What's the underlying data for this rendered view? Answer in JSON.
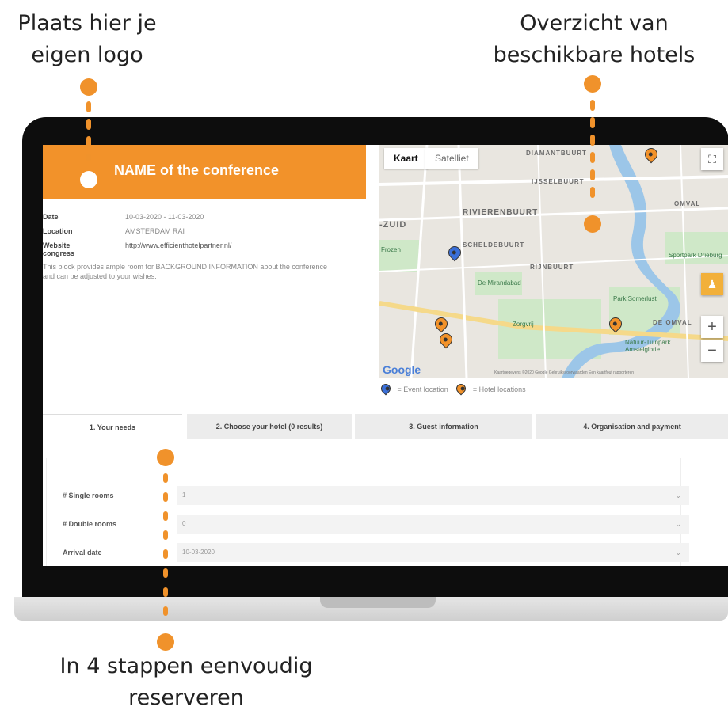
{
  "callouts": {
    "logo": [
      "Plaats hier je",
      "eigen logo"
    ],
    "hotels": [
      "Overzicht van",
      "beschikbare hotels"
    ],
    "steps": [
      "In 4 stappen eenvoudig",
      "reserveren"
    ]
  },
  "conference": {
    "title": "NAME of the conference",
    "info": [
      {
        "label": "Date",
        "value": "10-03-2020 - 11-03-2020"
      },
      {
        "label": "Location",
        "value": "AMSTERDAM RAI"
      },
      {
        "label": "Website congress",
        "value": "http://www.efficienthotelpartner.nl/"
      }
    ],
    "description": "This block provides ample room for BACKGROUND INFORMATION about the conference and can be adjusted to your wishes."
  },
  "map": {
    "tabs": {
      "kaart": "Kaart",
      "satelliet": "Satelliet"
    },
    "labels": [
      "DIAMANTBUURT",
      "IJSSELBUURT",
      "RIVIERENBUURT",
      "-ZUID",
      "SCHELDEBUURT",
      "RIJNBUURT",
      "DE OMVAL",
      "OMVAL"
    ],
    "parks": [
      "De Mirandabad",
      "Zorgvrij",
      "Park Somerlust",
      "Natuur-Tuinpark Amstelglorie",
      "Sportpark Drieburg",
      "Frozen"
    ],
    "google": "Google",
    "attribution": "Kaartgegevens ©2020 Google   Gebruiksvoorwaarden   Een kaartfout rapporteren",
    "zoom_in": "+",
    "zoom_out": "−"
  },
  "legend": {
    "event": "= Event location",
    "hotel": "= Hotel locations"
  },
  "steps": [
    {
      "label": "1. Your needs"
    },
    {
      "label": "2. Choose your hotel (0 results)"
    },
    {
      "label": "3. Guest information"
    },
    {
      "label": "4. Organisation and payment"
    }
  ],
  "form": {
    "fields": [
      {
        "label": "# Single rooms",
        "value": "1"
      },
      {
        "label": "# Double rooms",
        "value": "0"
      },
      {
        "label": "Arrival date",
        "value": "10-03-2020"
      }
    ]
  },
  "colors": {
    "accent": "#f2922a",
    "event_pin": "#3a6fd8",
    "hotel_pin": "#f2922a"
  }
}
